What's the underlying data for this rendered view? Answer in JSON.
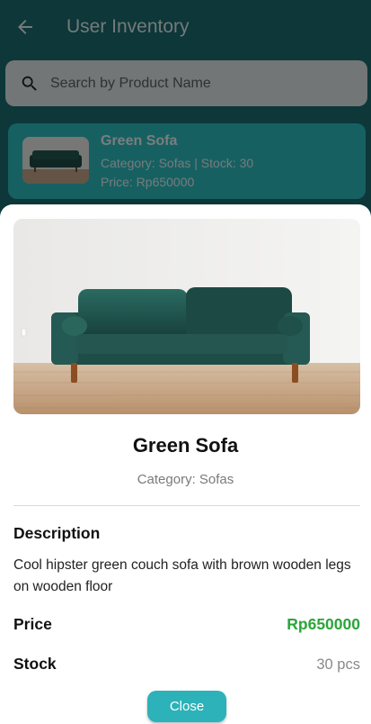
{
  "appbar": {
    "title": "User Inventory",
    "back_icon": "arrow-left-icon"
  },
  "search": {
    "placeholder": "Search by Product Name",
    "icon": "search-icon"
  },
  "list": {
    "items": [
      {
        "name": "Green Sofa",
        "meta": "Category: Sofas | Stock: 30",
        "price": "Price: Rp650000"
      }
    ]
  },
  "detail": {
    "name": "Green Sofa",
    "category": "Category: Sofas",
    "description_label": "Description",
    "description": "Cool hipster green couch sofa with brown wooden legs on wooden floor",
    "price_label": "Price",
    "price": "Rp650000",
    "stock_label": "Stock",
    "stock": "30 pcs",
    "close_label": "Close"
  },
  "colors": {
    "appbar": "#1a6f72",
    "card": "#2fc0c5",
    "accent": "#2cb2b8",
    "price": "#2aa63a"
  }
}
